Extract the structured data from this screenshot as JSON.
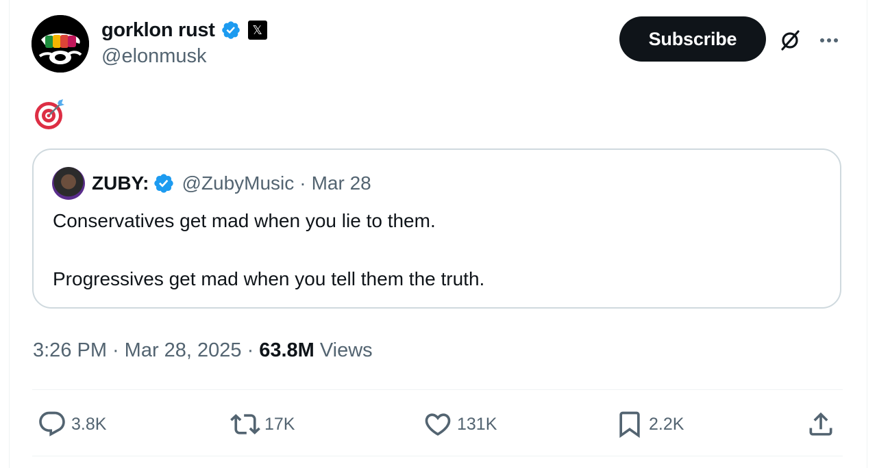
{
  "author": {
    "display_name": "gorklon rust",
    "handle": "@elonmusk"
  },
  "header": {
    "subscribe_label": "Subscribe"
  },
  "icons": {
    "verified": "verified-badge-icon",
    "affiliate": "x-affiliate-icon",
    "grok": "grok-icon",
    "more": "more-icon",
    "target_emoji": "direct-hit-emoji",
    "reply": "reply-icon",
    "repost": "repost-icon",
    "like": "like-icon",
    "bookmark": "bookmark-icon",
    "share": "share-icon"
  },
  "quote": {
    "display_name": "ZUBY:",
    "handle": "@ZubyMusic",
    "separator": "·",
    "date": "Mar 28",
    "line1": "Conservatives get mad when you lie to them.",
    "line2": "Progressives get mad when you tell them the truth."
  },
  "meta": {
    "time": "3:26 PM",
    "date": "Mar 28, 2025",
    "separator": "·",
    "views_count": "63.8M",
    "views_label": "Views"
  },
  "actions": {
    "replies": "3.8K",
    "reposts": "17K",
    "likes": "131K",
    "bookmarks": "2.2K"
  },
  "colors": {
    "text_primary": "#0f1419",
    "text_secondary": "#536471",
    "verified_blue": "#1d9bf0",
    "border": "#cfd9de",
    "divider": "#eff3f4"
  }
}
